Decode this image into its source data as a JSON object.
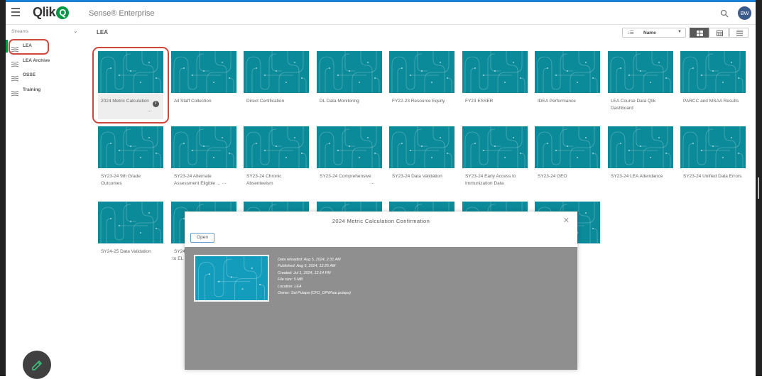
{
  "app": {
    "logo_text": "Qlik",
    "logo_mark": "Q",
    "product": "Sense® Enterprise",
    "user_initials": "BW"
  },
  "sidebar": {
    "header": "Streams",
    "items": [
      {
        "label": "LEA",
        "active": true
      },
      {
        "label": "LEA Archive",
        "active": false
      },
      {
        "label": "OSSE",
        "active": false
      },
      {
        "label": "Training",
        "active": false
      }
    ]
  },
  "main": {
    "title": "LEA",
    "sort_value": "Name",
    "apps": [
      "2024 Metric Calculation",
      "All Staff Collection",
      "Direct Certification",
      "DL Data Monitoring",
      "FY22-23 Resource Equity",
      "FY23 ESSER",
      "IDEA Performance",
      "LEA Course Data Qlik Dashboard",
      "PARCC and MSAA Results",
      "SY23-24 9th Grade Outcomes",
      "SY23-24 Alternate Assessment Eligible ...",
      "SY23-24 Chronic Absenteeism",
      "SY23-24 Comprehensive",
      "SY23-24 Data Validation",
      "SY23-24 Early Access to Immunization Data",
      "SY23-24 GEO",
      "SY23-24 LEA Attendance",
      "SY23-24 Unified Data Errors",
      "SY24-25 Data Validation",
      "SY24",
      "",
      "",
      "",
      "",
      ""
    ],
    "partial_label": "to EL"
  },
  "dialog": {
    "title": "2024 Metric Calculation Confirmation",
    "open_label": "Open",
    "meta": [
      "Data reloaded: Aug 5, 2024, 2:31 AM",
      "Published: Aug 5, 2024, 12:25 AM",
      "Created: Jul 1, 2024, 12:14 PM",
      "File size: 5 MB",
      "Location: LEA",
      "Owner: Sai Pulapa (CFO_DPW\\sai.pulapa)"
    ]
  },
  "colors": {
    "accent": "#009845",
    "thumb": "#0b8a9a",
    "highlight": "#d0473e",
    "avatar": "#3a5a8c"
  }
}
